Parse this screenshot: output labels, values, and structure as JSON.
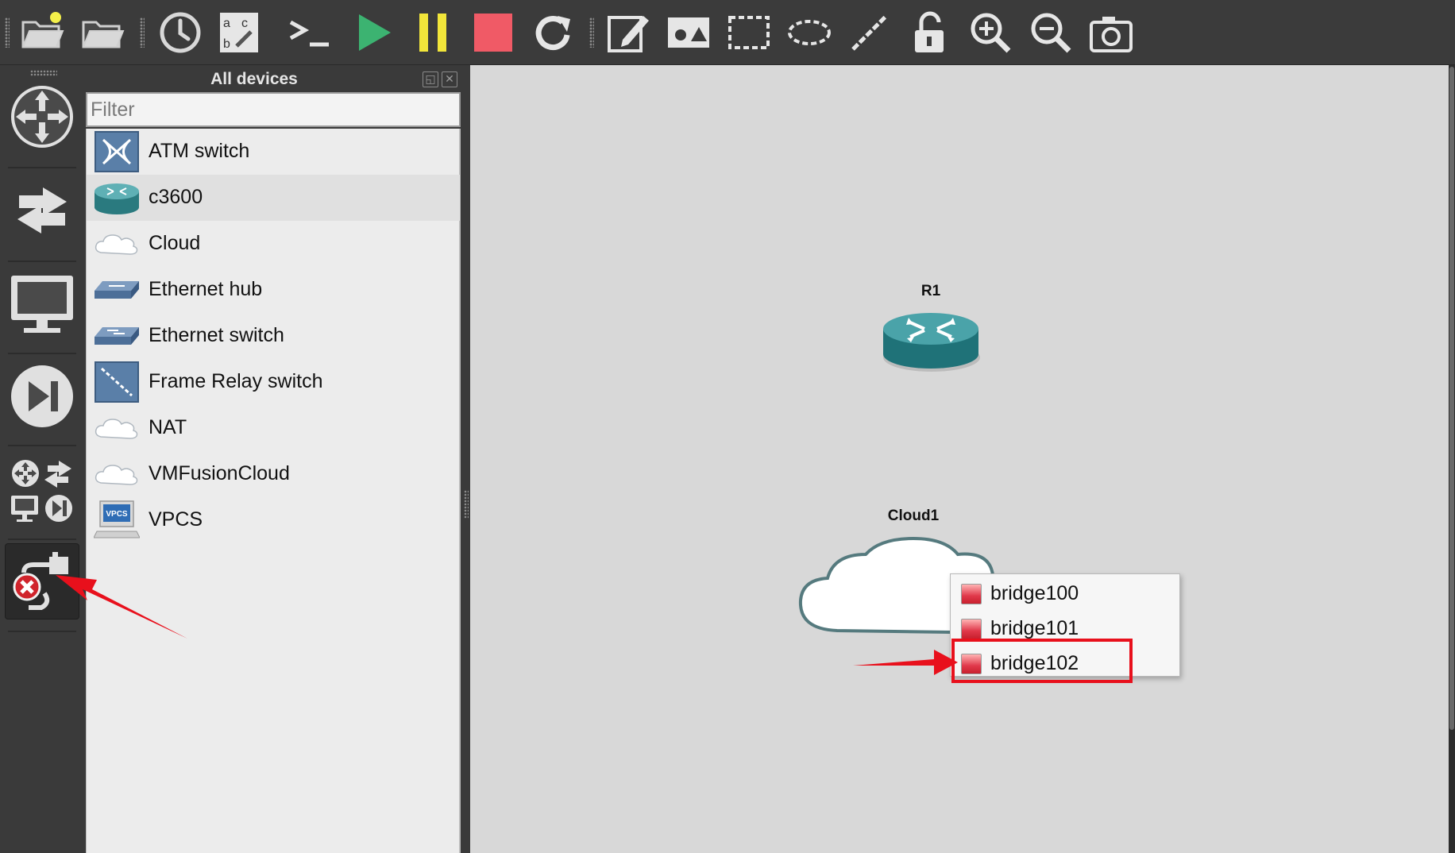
{
  "toolbar": {
    "buttons": [
      {
        "name": "new-project-icon"
      },
      {
        "name": "open-project-icon"
      },
      {
        "name": "snapshot-clock-icon"
      },
      {
        "name": "show-interface-labels-icon"
      },
      {
        "name": "console-all-icon"
      },
      {
        "name": "start-all-icon"
      },
      {
        "name": "suspend-all-icon"
      },
      {
        "name": "stop-all-icon"
      },
      {
        "name": "reload-all-icon"
      },
      {
        "name": "add-note-icon"
      },
      {
        "name": "insert-picture-icon"
      },
      {
        "name": "draw-rectangle-icon"
      },
      {
        "name": "draw-ellipse-icon"
      },
      {
        "name": "draw-line-icon"
      },
      {
        "name": "lock-items-icon"
      },
      {
        "name": "zoom-in-icon"
      },
      {
        "name": "zoom-out-icon"
      },
      {
        "name": "screenshot-icon"
      }
    ],
    "colors": {
      "play": "#3cb371",
      "pause": "#f2e63a",
      "stop": "#f05a66"
    }
  },
  "dock": {
    "buttons": [
      "browse-routers-icon",
      "browse-switches-icon",
      "browse-end-devices-icon",
      "browse-security-devices-icon",
      "browse-all-devices-icon",
      "add-link-icon"
    ],
    "active": "add-link-icon"
  },
  "devices_panel": {
    "title": "All devices",
    "filter_placeholder": "Filter",
    "items": [
      {
        "label": "ATM switch",
        "icon": "atm-switch-icon"
      },
      {
        "label": "c3600",
        "icon": "router-icon"
      },
      {
        "label": "Cloud",
        "icon": "cloud-icon"
      },
      {
        "label": "Ethernet hub",
        "icon": "ethernet-hub-icon"
      },
      {
        "label": "Ethernet switch",
        "icon": "ethernet-switch-icon"
      },
      {
        "label": "Frame Relay switch",
        "icon": "frame-relay-switch-icon"
      },
      {
        "label": "NAT",
        "icon": "cloud-icon"
      },
      {
        "label": "VMFusionCloud",
        "icon": "cloud-icon"
      },
      {
        "label": "VPCS",
        "icon": "vpcs-icon"
      }
    ],
    "highlighted": "c3600"
  },
  "canvas": {
    "nodes": [
      {
        "label": "R1",
        "type": "router"
      },
      {
        "label": "Cloud1",
        "type": "cloud"
      }
    ],
    "context_menu": {
      "items": [
        {
          "label": "bridge100",
          "status": "down"
        },
        {
          "label": "bridge101",
          "status": "down"
        },
        {
          "label": "bridge102",
          "status": "down"
        }
      ],
      "highlighted": "bridge102"
    }
  },
  "annotations": {
    "arrow_color": "#e8101c"
  }
}
